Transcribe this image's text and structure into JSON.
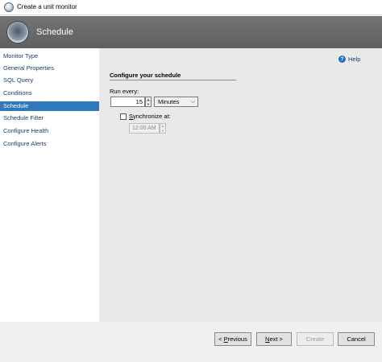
{
  "window": {
    "title": "Create a unit monitor"
  },
  "banner": {
    "heading": "Schedule"
  },
  "nav": {
    "items": [
      {
        "label": "Monitor Type"
      },
      {
        "label": "General Properties"
      },
      {
        "label": "SQL Query"
      },
      {
        "label": "Conditions"
      },
      {
        "label": "Schedule",
        "selected": true
      },
      {
        "label": "Schedule Filter"
      },
      {
        "label": "Configure Health"
      },
      {
        "label": "Configure Alerts"
      }
    ]
  },
  "content": {
    "help_label": "Help",
    "help_icon": "help-icon",
    "section_title": "Configure your schedule",
    "run_every_label": "Run every:",
    "run_every_value": "15",
    "unit_value": "Minutes",
    "synchronize_prefix": "S",
    "synchronize_rest": "ynchronize at:",
    "synchronize_checked": false,
    "sync_time_value": "12:00 AM"
  },
  "footer": {
    "previous_prefix": "< ",
    "previous_acc": "P",
    "previous_rest": "revious",
    "next_acc": "N",
    "next_rest": "ext >",
    "create_label": "Create",
    "cancel_label": "Cancel"
  },
  "colors": {
    "banner": "#666666",
    "selected_nav": "#3078be",
    "content_bg": "#e9e9e9",
    "link": "#1a3a6b"
  }
}
